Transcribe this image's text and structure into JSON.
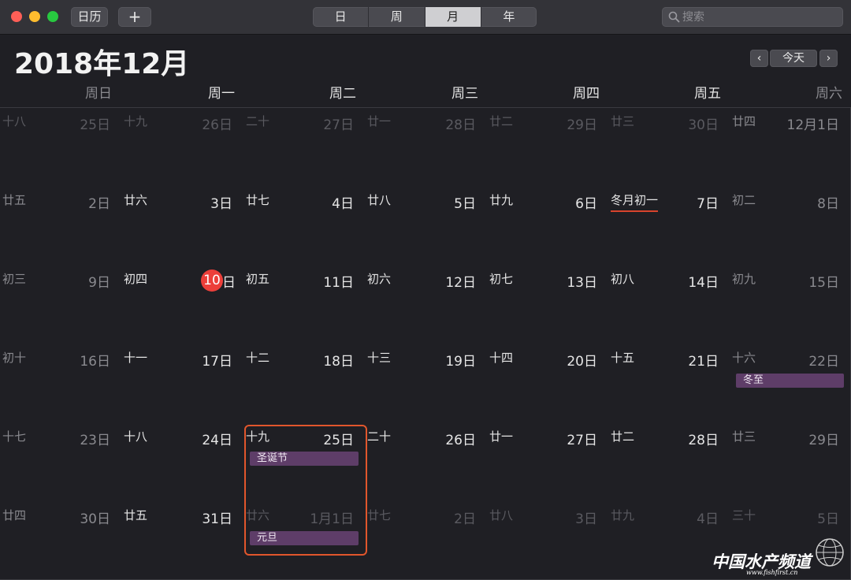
{
  "toolbar": {
    "calendar_label": "日历",
    "add_label": "+",
    "views": [
      "日",
      "周",
      "月",
      "年"
    ],
    "active_view": "月",
    "search_placeholder": "搜索"
  },
  "header": {
    "title": "2018年12月",
    "prev": "‹",
    "today": "今天",
    "next": "›"
  },
  "weekdays": [
    "周日",
    "周一",
    "周二",
    "周三",
    "周四",
    "周五",
    "周六"
  ],
  "weeks": [
    [
      {
        "lunar": "十八",
        "day": "25日",
        "other": true
      },
      {
        "lunar": "十九",
        "day": "26日",
        "other": true
      },
      {
        "lunar": "二十",
        "day": "27日",
        "other": true
      },
      {
        "lunar": "廿一",
        "day": "28日",
        "other": true
      },
      {
        "lunar": "廿二",
        "day": "29日",
        "other": true
      },
      {
        "lunar": "廿三",
        "day": "30日",
        "other": true
      },
      {
        "lunar": "廿四",
        "day": "12月1日"
      }
    ],
    [
      {
        "lunar": "廿五",
        "day": "2日"
      },
      {
        "lunar": "廿六",
        "day": "3日"
      },
      {
        "lunar": "廿七",
        "day": "4日"
      },
      {
        "lunar": "廿八",
        "day": "5日"
      },
      {
        "lunar": "廿九",
        "day": "6日"
      },
      {
        "lunar": "冬月初一",
        "day": "7日",
        "underline": true
      },
      {
        "lunar": "初二",
        "day": "8日"
      }
    ],
    [
      {
        "lunar": "初三",
        "day": "9日"
      },
      {
        "lunar": "初四",
        "day": "日",
        "today": "10"
      },
      {
        "lunar": "初五",
        "day": "11日"
      },
      {
        "lunar": "初六",
        "day": "12日"
      },
      {
        "lunar": "初七",
        "day": "13日"
      },
      {
        "lunar": "初八",
        "day": "14日"
      },
      {
        "lunar": "初九",
        "day": "15日"
      }
    ],
    [
      {
        "lunar": "初十",
        "day": "16日"
      },
      {
        "lunar": "十一",
        "day": "17日"
      },
      {
        "lunar": "十二",
        "day": "18日"
      },
      {
        "lunar": "十三",
        "day": "19日"
      },
      {
        "lunar": "十四",
        "day": "20日"
      },
      {
        "lunar": "十五",
        "day": "21日"
      },
      {
        "lunar": "十六",
        "day": "22日",
        "event": "冬至"
      }
    ],
    [
      {
        "lunar": "十七",
        "day": "23日"
      },
      {
        "lunar": "十八",
        "day": "24日"
      },
      {
        "lunar": "十九",
        "day": "25日",
        "event": "圣诞节"
      },
      {
        "lunar": "二十",
        "day": "26日"
      },
      {
        "lunar": "廿一",
        "day": "27日"
      },
      {
        "lunar": "廿二",
        "day": "28日"
      },
      {
        "lunar": "廿三",
        "day": "29日"
      }
    ],
    [
      {
        "lunar": "廿四",
        "day": "30日"
      },
      {
        "lunar": "廿五",
        "day": "31日"
      },
      {
        "lunar": "廿六",
        "day": "1月1日",
        "other": true,
        "event": "元旦"
      },
      {
        "lunar": "廿七",
        "day": "2日",
        "other": true
      },
      {
        "lunar": "廿八",
        "day": "3日",
        "other": true
      },
      {
        "lunar": "廿九",
        "day": "4日",
        "other": true
      },
      {
        "lunar": "三十",
        "day": "5日",
        "other": true
      }
    ]
  ],
  "watermark": {
    "title": "中国水产频道",
    "url": "www.fishfirst.cn"
  },
  "colors": {
    "today": "#ec3f3a",
    "event": "#5e3d68",
    "highlight": "#e1562c"
  }
}
